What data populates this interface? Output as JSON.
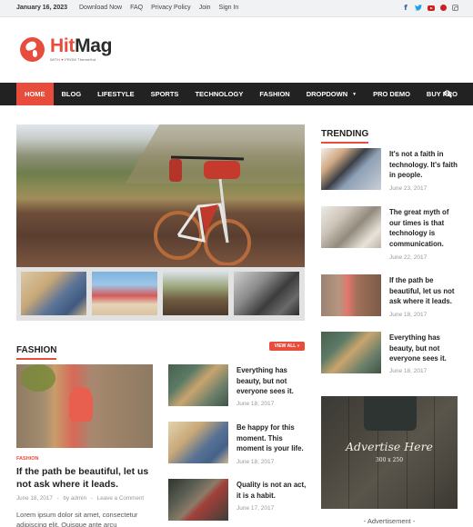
{
  "topbar": {
    "date": "January 16, 2023",
    "links": [
      "Download Now",
      "FAQ",
      "Privacy Policy",
      "Join",
      "Sign In"
    ],
    "social": [
      "facebook-icon",
      "twitter-icon",
      "youtube-icon",
      "pinterest-icon",
      "instagram-icon"
    ]
  },
  "header": {
    "brand_part1": "Hit",
    "brand_part2": "Mag",
    "tagline_with": "WITH",
    "tagline_heart": "♥",
    "tagline_from": "FROM ThemeHut"
  },
  "nav": {
    "items": [
      "Home",
      "Blog",
      "Lifestyle",
      "Sports",
      "Technology",
      "Fashion",
      "Dropdown",
      "Pro Demo",
      "Buy Pro"
    ],
    "active": "Home",
    "dropdown_caret": "▼"
  },
  "colors": {
    "accent": "#e74c3c",
    "nav_bg": "#222222",
    "topbar_bg": "#f1f2f3"
  },
  "trending": {
    "title": "Trending",
    "items": [
      {
        "title": "It's not a faith in technology. It's faith in people.",
        "date": "June 23, 2017"
      },
      {
        "title": "The great myth of our times is that technology is communication.",
        "date": "June 22, 2017"
      },
      {
        "title": "If the path be beautiful, let us not ask where it leads.",
        "date": "June 18, 2017"
      },
      {
        "title": "Everything has beauty, but not everyone sees it.",
        "date": "June 18, 2017"
      }
    ]
  },
  "ad": {
    "headline": "Advertise Here",
    "size": "300 x 250",
    "label": "- Advertisement -"
  },
  "fashion": {
    "title": "Fashion",
    "view_all": "View All »",
    "featured": {
      "category": "Fashion",
      "title": "If the path be beautiful, let us not ask where it leads.",
      "date": "June 18, 2017",
      "author": "by admin",
      "comments": "Leave a Comment",
      "separator": "-",
      "excerpt": "Lorem ipsum dolor sit amet, consectetur adipiscing elit. Quisque ante arcu"
    },
    "list": [
      {
        "title": "Everything has beauty, but not everyone sees it.",
        "date": "June 18, 2017"
      },
      {
        "title": "Be happy for this moment. This moment is your life.",
        "date": "June 18, 2017"
      },
      {
        "title": "Quality is not an act, it is a habit.",
        "date": "June 17, 2017"
      }
    ]
  }
}
